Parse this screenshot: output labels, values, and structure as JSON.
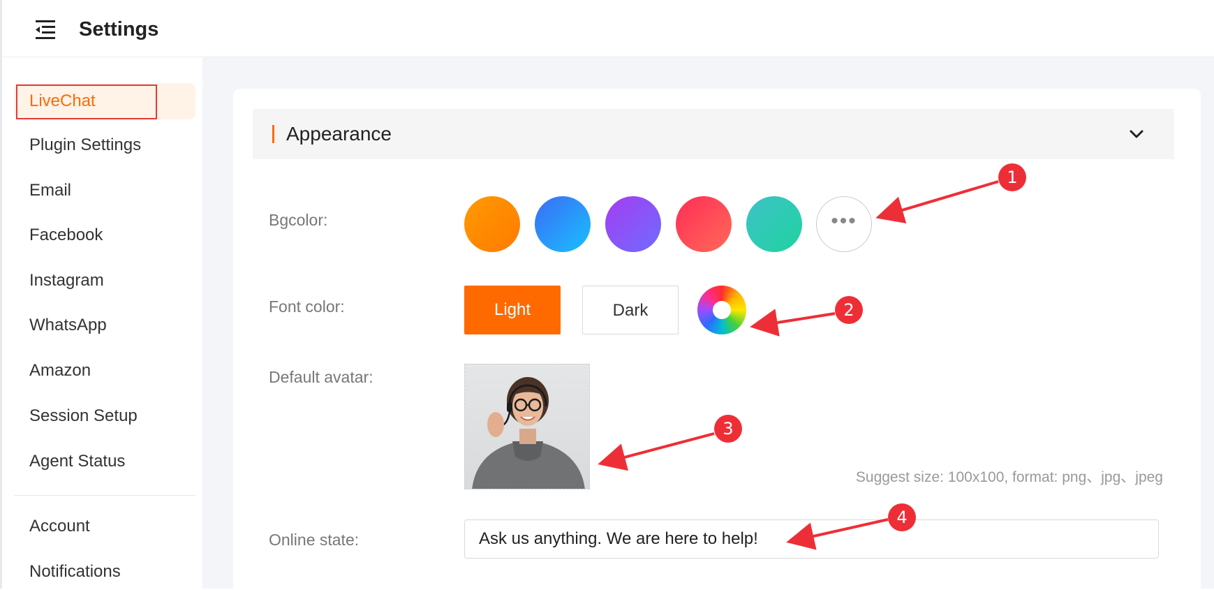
{
  "header": {
    "title": "Settings",
    "menu_icon": "menu-collapse-icon"
  },
  "sidebar": {
    "items": [
      {
        "label": "LiveChat",
        "active": true
      },
      {
        "label": "Plugin Settings"
      },
      {
        "label": "Email"
      },
      {
        "label": "Facebook"
      },
      {
        "label": "Instagram"
      },
      {
        "label": "WhatsApp"
      },
      {
        "label": "Amazon"
      },
      {
        "label": "Session Setup"
      },
      {
        "label": "Agent Status"
      },
      {
        "label": "Account"
      },
      {
        "label": "Notifications"
      }
    ]
  },
  "appearance": {
    "title": "Appearance",
    "accent_color": "#ff6a00",
    "bgcolor": {
      "label": "Bgcolor:",
      "swatches": [
        {
          "name": "orange",
          "from": "#ff9a00",
          "to": "#ff7a00"
        },
        {
          "name": "blue",
          "from": "#3b6cf6",
          "to": "#19c0ff"
        },
        {
          "name": "purple",
          "from": "#a43df0",
          "to": "#6f6cff"
        },
        {
          "name": "red",
          "from": "#ff2d55",
          "to": "#ff6a5a"
        },
        {
          "name": "teal",
          "from": "#3ec2c7",
          "to": "#1fd3a0"
        }
      ],
      "more_label": "•••"
    },
    "font_color": {
      "label": "Font color:",
      "light_label": "Light",
      "dark_label": "Dark"
    },
    "default_avatar": {
      "label": "Default avatar:",
      "hint": "Suggest size: 100x100, format: png、jpg、jpeg"
    },
    "online_state": {
      "label": "Online state:",
      "value": "Ask us anything. We are here to help!"
    }
  },
  "annotations": [
    "1",
    "2",
    "3",
    "4"
  ],
  "annotation_color": "#ee2e36"
}
